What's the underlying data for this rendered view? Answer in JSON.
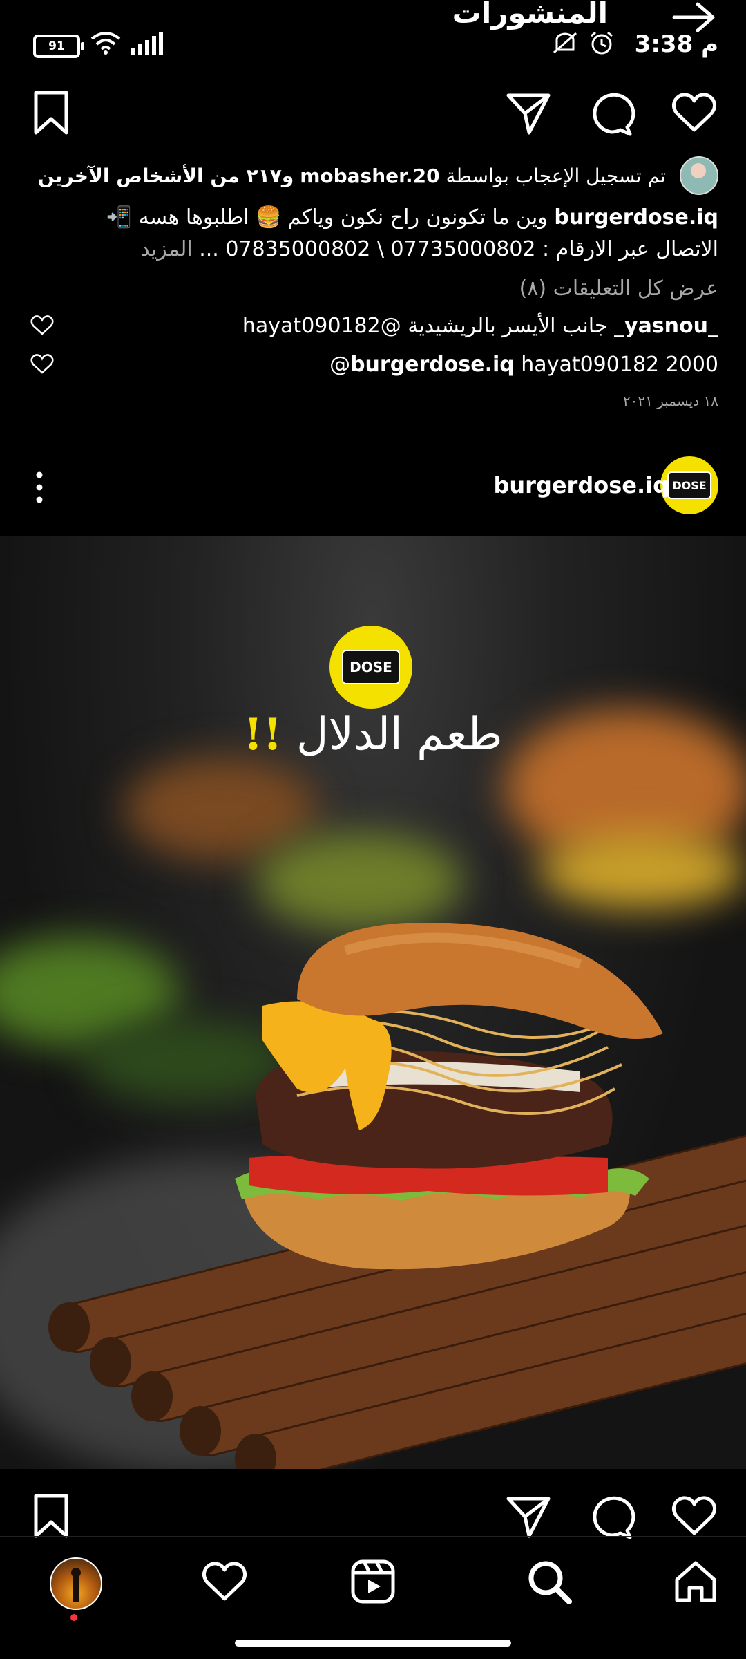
{
  "status": {
    "time": "3:38",
    "period": "م",
    "battery": "91"
  },
  "header": {
    "title": "المنشورات"
  },
  "post1": {
    "liked_by_prefix": "تم تسجيل الإعجاب بواسطة",
    "liked_by_user": "mobasher.20",
    "liked_by_suffix": "و٢١٧ من الأشخاص الآخرين",
    "caption_user": "burgerdose.iq",
    "caption_line1": "وين ما تكونون راح نكون وياكم 🍔 اطلبوها هسه 📲",
    "caption_line2": "الاتصال عبر الارقام : 07735000802 \\ 07835000802 ...",
    "more": "المزيد",
    "view_comments": "عرض كل التعليقات (٨)",
    "comments": [
      {
        "user": "_yasnou_",
        "text": "جانب الأيسر بالريشيدية @hayat090182"
      },
      {
        "user": "burgerdose.iq",
        "text": "hayat090182 2000@"
      }
    ],
    "date": "١٨ ديسمبر ٢٠٢١"
  },
  "post2": {
    "username": "burgerdose.iq",
    "logo_text": "DOSE",
    "image_headline": "طعم الدلال",
    "image_headline_marks": "!!"
  },
  "colors": {
    "accent_yellow": "#f5e100",
    "notification_dot": "#ff3040"
  },
  "icons": {
    "action_row": [
      "heart-icon",
      "comment-icon",
      "share-icon",
      "bookmark-icon"
    ],
    "nav": [
      "home-icon",
      "search-icon",
      "reels-icon",
      "activity-heart-icon",
      "profile-avatar"
    ]
  }
}
